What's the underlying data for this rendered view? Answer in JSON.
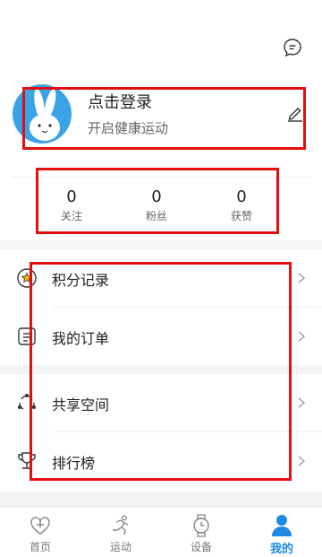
{
  "profile": {
    "login_title": "点击登录",
    "subtitle": "开启健康运动"
  },
  "stats": [
    {
      "value": "0",
      "label": "关注"
    },
    {
      "value": "0",
      "label": "粉丝"
    },
    {
      "value": "0",
      "label": "获赞"
    }
  ],
  "menu": [
    {
      "label": "积分记录",
      "icon": "points-icon"
    },
    {
      "label": "我的订单",
      "icon": "order-icon"
    },
    {
      "label": "共享空间",
      "icon": "share-space-icon"
    },
    {
      "label": "排行榜",
      "icon": "trophy-icon"
    }
  ],
  "tabs": [
    {
      "label": "首页",
      "icon": "home-icon",
      "active": false
    },
    {
      "label": "运动",
      "icon": "run-icon",
      "active": false
    },
    {
      "label": "设备",
      "icon": "watch-icon",
      "active": false
    },
    {
      "label": "我的",
      "icon": "profile-icon",
      "active": true
    }
  ],
  "colors": {
    "accent": "#1e88e5",
    "highlight": "#e01010",
    "avatar_bg": "#3aa3e6"
  }
}
